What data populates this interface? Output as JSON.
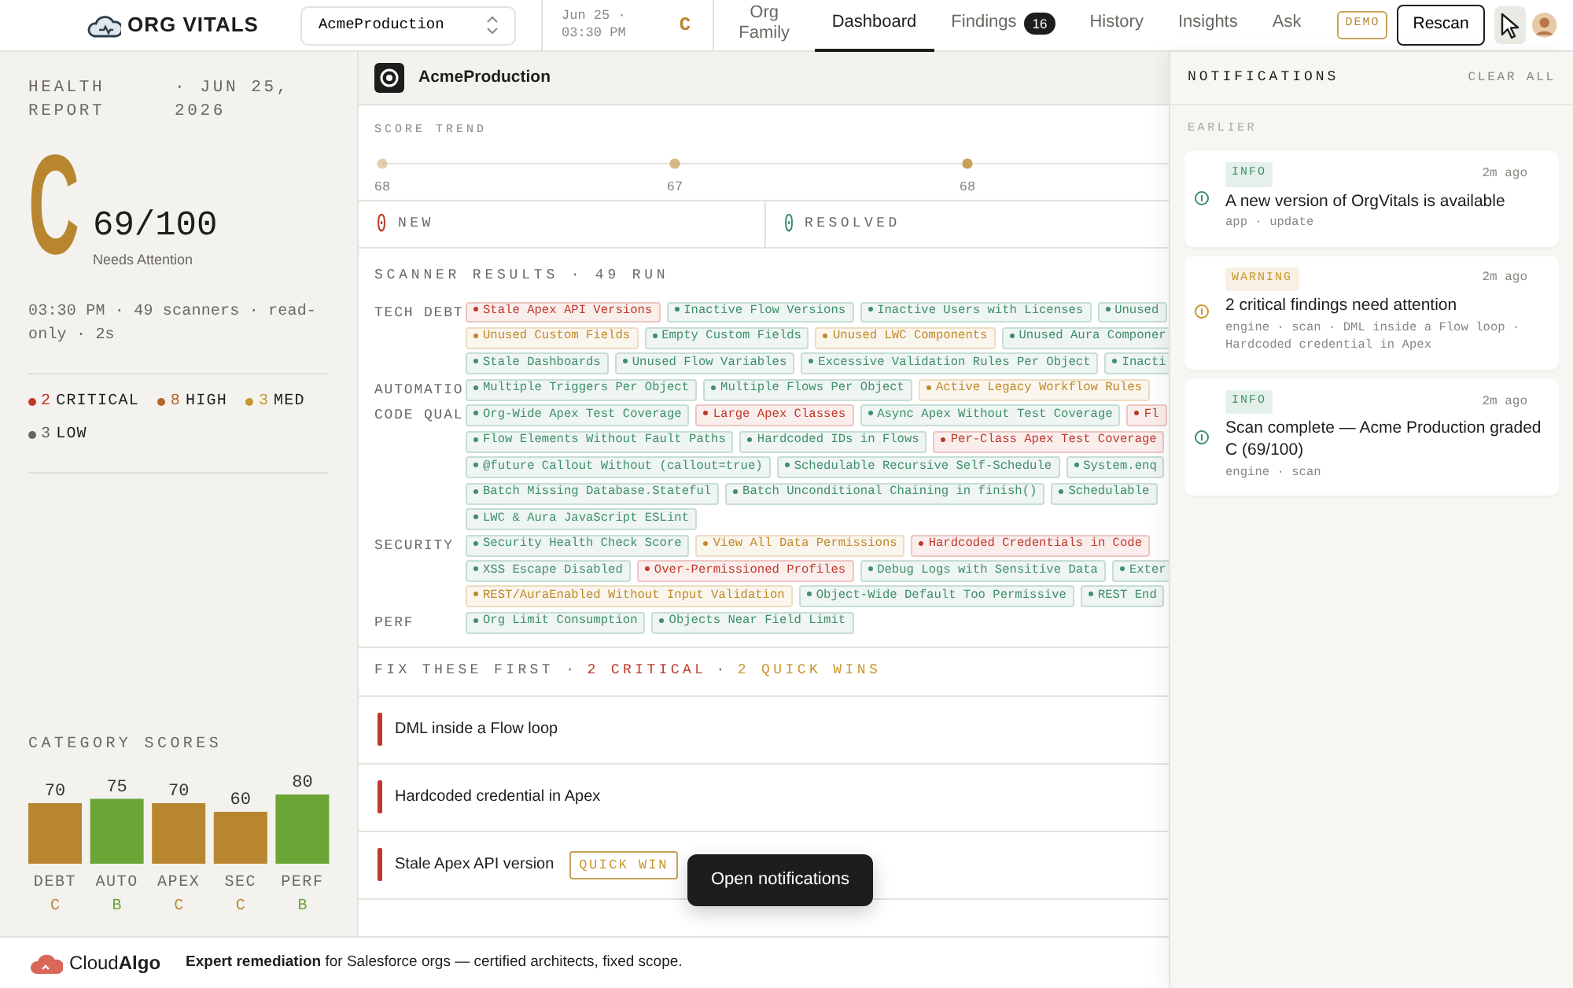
{
  "topbar": {
    "logo": "ORG VITALS",
    "org_select": "AcmeProduction",
    "scan_time": "Jun 25 · 03:30 PM",
    "grade": "C",
    "tabs": [
      {
        "label": "Org Family",
        "selected": false
      },
      {
        "label": "Dashboard",
        "selected": true
      },
      {
        "label": "Findings",
        "badge": "16",
        "selected": false
      },
      {
        "label": "History",
        "selected": false
      },
      {
        "label": "Insights",
        "selected": false
      },
      {
        "label": "Ask",
        "selected": false
      }
    ],
    "demo_badge": "DEMO",
    "rescan": "Rescan"
  },
  "report": {
    "title": "HEALTH REPORT",
    "date": "· JUN 25, 2026",
    "grade": "C",
    "score": "69/100",
    "status": "Needs Attention",
    "meta": "03:30 PM · 49 scanners · read-only · 2s",
    "severities": [
      {
        "count": "2",
        "label": "CRITICAL",
        "color": "#c0392b"
      },
      {
        "count": "8",
        "label": "HIGH",
        "color": "#b5652a"
      },
      {
        "count": "3",
        "label": "MED",
        "color": "#c9962b"
      },
      {
        "count": "3",
        "label": "LOW",
        "color": "#666666"
      }
    ],
    "category_scores": {
      "title": "CATEGORY SCORES",
      "grades": [
        "C",
        "B",
        "C",
        "C",
        "B"
      ],
      "chart_data": {
        "type": "bar",
        "categories": [
          "DEBT",
          "AUTO",
          "APEX",
          "SEC",
          "PERF"
        ],
        "values": [
          70,
          75,
          70,
          60,
          80
        ],
        "data_labels": true
      }
    }
  },
  "org": {
    "name": "AcmeProduction"
  },
  "score_trend": {
    "title": "SCORE TREND",
    "points": [
      "68",
      "67",
      "68"
    ]
  },
  "changes": [
    {
      "count": "0",
      "label": "NEW",
      "color": "#c0392b"
    },
    {
      "count": "0",
      "label": "RESOLVED",
      "color": "#3f8f6a"
    }
  ],
  "scanner_results": {
    "title": "SCANNER RESULTS · 49 RUN",
    "categories": [
      {
        "label": "TECH DEBT",
        "rows": [
          [
            {
              "text": "Stale Apex API Versions",
              "color": "#c0392b"
            },
            {
              "text": "Inactive Flow Versions",
              "color": "#3f8f6a"
            },
            {
              "text": "Inactive Users with Licenses",
              "color": "#3f8f6a"
            },
            {
              "text": "Unused",
              "color": "#3f8f6a"
            }
          ],
          [
            {
              "text": "Unused Custom Fields",
              "color": "#c08a2a"
            },
            {
              "text": "Empty Custom Fields",
              "color": "#3f8f6a"
            },
            {
              "text": "Unused LWC Components",
              "color": "#c08a2a"
            },
            {
              "text": "Unused Aura Componer",
              "color": "#3f8f6a"
            }
          ],
          [
            {
              "text": "Stale Dashboards",
              "color": "#3f8f6a"
            },
            {
              "text": "Unused Flow Variables",
              "color": "#3f8f6a"
            },
            {
              "text": "Excessive Validation Rules Per Object",
              "color": "#3f8f6a"
            },
            {
              "text": "Inacti",
              "color": "#3f8f6a"
            }
          ]
        ]
      },
      {
        "label": "AUTOMATIO",
        "rows": [
          [
            {
              "text": "Multiple Triggers Per Object",
              "color": "#3f8f6a"
            },
            {
              "text": "Multiple Flows Per Object",
              "color": "#3f8f6a"
            },
            {
              "text": "Active Legacy Workflow Rules",
              "color": "#c08a2a"
            }
          ]
        ]
      },
      {
        "label": "CODE QUAL",
        "rows": [
          [
            {
              "text": "Org-Wide Apex Test Coverage",
              "color": "#3f8f6a"
            },
            {
              "text": "Large Apex Classes",
              "color": "#c0392b"
            },
            {
              "text": "Async Apex Without Test Coverage",
              "color": "#3f8f6a"
            },
            {
              "text": "Fl",
              "color": "#c0392b"
            }
          ],
          [
            {
              "text": "Flow Elements Without Fault Paths",
              "color": "#3f8f6a"
            },
            {
              "text": "Hardcoded IDs in Flows",
              "color": "#3f8f6a"
            },
            {
              "text": "Per-Class Apex Test Coverage",
              "color": "#c0392b"
            }
          ],
          [
            {
              "text": "@future Callout Without (callout=true)",
              "color": "#3f8f6a"
            },
            {
              "text": "Schedulable Recursive Self-Schedule",
              "color": "#3f8f6a"
            },
            {
              "text": "System.enq",
              "color": "#3f8f6a"
            }
          ],
          [
            {
              "text": "Batch Missing Database.Stateful",
              "color": "#3f8f6a"
            },
            {
              "text": "Batch Unconditional Chaining in finish()",
              "color": "#3f8f6a"
            },
            {
              "text": "Schedulable",
              "color": "#3f8f6a"
            }
          ],
          [
            {
              "text": "LWC & Aura JavaScript ESLint",
              "color": "#3f8f6a"
            }
          ]
        ]
      },
      {
        "label": "SECURITY",
        "rows": [
          [
            {
              "text": "Security Health Check Score",
              "color": "#3f8f6a"
            },
            {
              "text": "View All Data Permissions",
              "color": "#c08a2a"
            },
            {
              "text": "Hardcoded Credentials in Code",
              "color": "#c0392b"
            }
          ],
          [
            {
              "text": "XSS Escape Disabled",
              "color": "#3f8f6a"
            },
            {
              "text": "Over-Permissioned Profiles",
              "color": "#c0392b"
            },
            {
              "text": "Debug Logs with Sensitive Data",
              "color": "#3f8f6a"
            },
            {
              "text": "Exter",
              "color": "#3f8f6a"
            }
          ],
          [
            {
              "text": "REST/AuraEnabled Without Input Validation",
              "color": "#c08a2a"
            },
            {
              "text": "Object-Wide Default Too Permissive",
              "color": "#3f8f6a"
            },
            {
              "text": "REST End",
              "color": "#3f8f6a"
            }
          ]
        ]
      },
      {
        "label": "PERF",
        "rows": [
          [
            {
              "text": "Org Limit Consumption",
              "color": "#3f8f6a"
            },
            {
              "text": "Objects Near Field Limit",
              "color": "#3f8f6a"
            }
          ]
        ]
      }
    ]
  },
  "fix_first": {
    "parts": [
      {
        "text": "FIX THESE FIRST ·",
        "color": "#6b6862"
      },
      {
        "text": "2 CRITICAL",
        "color": "#c0392b"
      },
      {
        "text": "·",
        "color": "#6b6862"
      },
      {
        "text": "2 QUICK WINS",
        "color": "#c9962b"
      }
    ],
    "items": [
      {
        "title": "DML inside a Flow loop"
      },
      {
        "title": "Hardcoded credential in Apex"
      },
      {
        "title": "Stale Apex API version",
        "badge": "QUICK WIN"
      }
    ]
  },
  "footer": {
    "brand": "Cloud**Algo**",
    "text": "**Expert remediation** for Salesforce orgs — certified architects, fixed scope."
  },
  "notifications": {
    "title": "NOTIFICATIONS",
    "clear": "CLEAR ALL",
    "group": "EARLIER",
    "items": [
      {
        "color": "#3f8f6a",
        "tag": "INFO",
        "time": "2m ago",
        "title": "A new version of OrgVitals is available",
        "meta": "app · update"
      },
      {
        "color": "#c9962b",
        "tag": "WARNING",
        "time": "2m ago",
        "title": "2 critical findings need attention",
        "meta": "engine · scan · DML inside a Flow loop · Hardcoded credential in Apex"
      },
      {
        "color": "#3f8f6a",
        "tag": "INFO",
        "time": "2m ago",
        "title": "Scan complete — Acme Production graded C (69/100)",
        "meta": "engine · scan"
      }
    ]
  },
  "tooltip": "Open notifications"
}
